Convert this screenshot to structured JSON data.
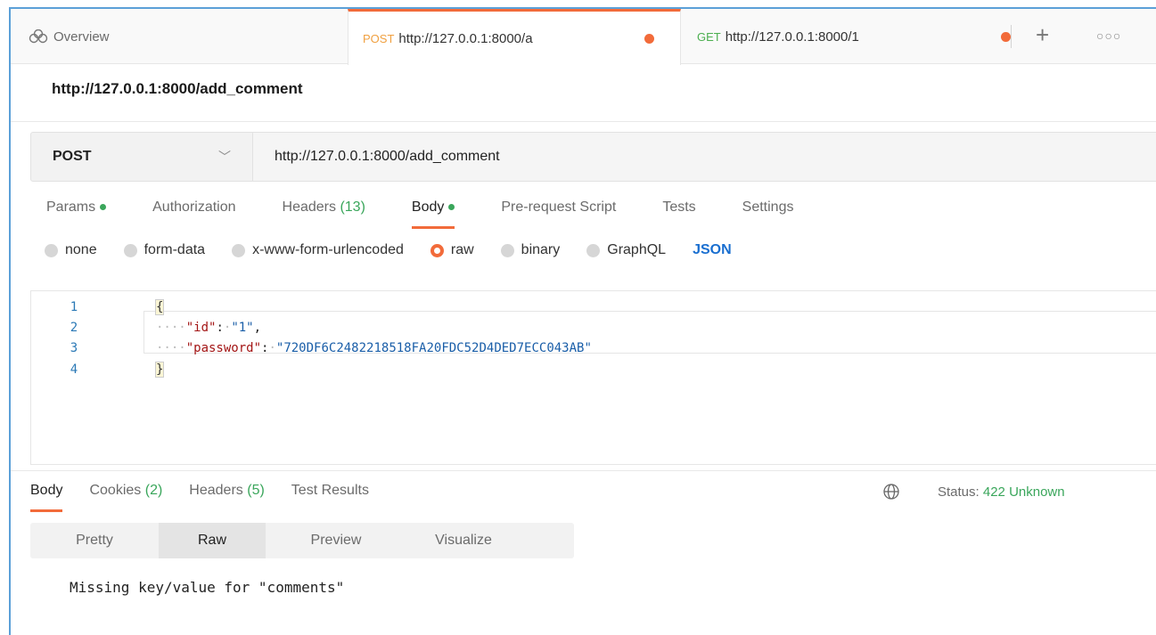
{
  "tabs": {
    "overview_label": "Overview",
    "active": {
      "method": "POST",
      "url": "http://127.0.0.1:8000/a"
    },
    "second": {
      "method": "GET",
      "url": "http://127.0.0.1:8000/1"
    },
    "new_tab_icon": "plus-icon",
    "more_icon": "more-horizontal-icon"
  },
  "request": {
    "title": "http://127.0.0.1:8000/add_comment",
    "method": "POST",
    "url": "http://127.0.0.1:8000/add_comment"
  },
  "request_tabs": {
    "params": "Params",
    "authorization": "Authorization",
    "headers": "Headers",
    "headers_count": "(13)",
    "body": "Body",
    "prerequest": "Pre-request Script",
    "tests": "Tests",
    "settings": "Settings"
  },
  "body_types": {
    "none": "none",
    "form_data": "form-data",
    "urlencoded": "x-www-form-urlencoded",
    "raw": "raw",
    "binary": "binary",
    "graphql": "GraphQL",
    "format": "JSON",
    "selected": "raw"
  },
  "editor": {
    "line_numbers": [
      "1",
      "2",
      "3",
      "4"
    ],
    "open_brace": "{",
    "close_brace": "}",
    "id_key": "\"id\"",
    "id_value": "\"1\"",
    "password_key": "\"password\"",
    "password_value": "\"720DF6C2482218518FA20FDC52D4DED7ECC043AB\""
  },
  "response": {
    "tabs": {
      "body": "Body",
      "cookies": "Cookies",
      "cookies_count": "(2)",
      "headers": "Headers",
      "headers_count": "(5)",
      "test_results": "Test Results"
    },
    "status_label": "Status:",
    "status_value": "422 Unknown",
    "view_tabs": {
      "pretty": "Pretty",
      "raw": "Raw",
      "preview": "Preview",
      "visualize": "Visualize"
    },
    "output": "Missing key/value for \"comments\""
  },
  "colors": {
    "accent": "#f26b3a",
    "success_green": "#3aa65b",
    "json_blue": "#1a6fd0"
  }
}
